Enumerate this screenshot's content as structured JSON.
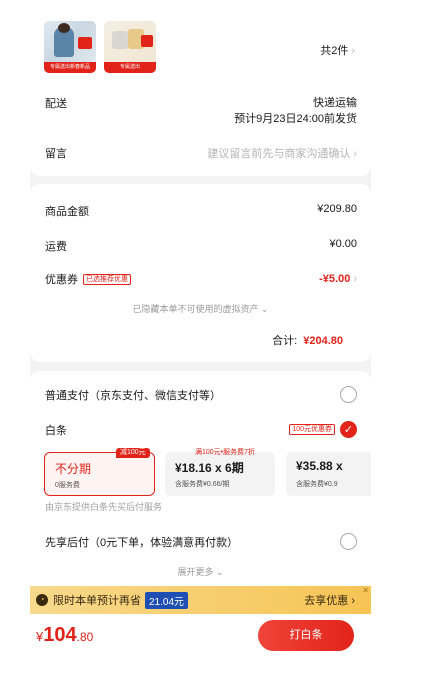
{
  "colors": {
    "accent": "#e2231a",
    "banner_bg": "#f7c75a",
    "page_bg": "#f3f3f3"
  },
  "product": {
    "count_label": "共2件",
    "thumbs": [
      {
        "caption": "专属送出新春新品"
      },
      {
        "caption": "专属送出"
      }
    ]
  },
  "shipping": {
    "label": "配送",
    "method": "快递运输",
    "eta": "预计9月23日24:00前发货"
  },
  "remark": {
    "label": "留言",
    "placeholder": "建议留言前先与商家沟通确认"
  },
  "price": {
    "goods_label": "商品金额",
    "goods_value": "¥209.80",
    "freight_label": "运费",
    "freight_value": "¥0.00",
    "coupon_label": "优惠券",
    "coupon_tag": "已选推荐优惠",
    "coupon_value": "-¥5.00",
    "hidden_note": "已隐藏本单不可使用的虚拟资产",
    "total_label": "合计:",
    "total_value": "¥204.80"
  },
  "payment": {
    "normal_label": "普通支付（京东支付、微信支付等）",
    "baitiao_label": "白条",
    "baitiao_tag": "100元优惠券",
    "plans": [
      {
        "badge": "减100元",
        "title": "不分期",
        "sub": "0服务费"
      },
      {
        "badge": "满100元•服务费7折",
        "title": "¥18.16 x 6期",
        "sub": "含服务费¥0.66/期"
      },
      {
        "title": "¥35.88 x",
        "sub": "含服务费¥0.9"
      }
    ],
    "provider_note": "由京东提供白条先买后付服务",
    "later_label": "先享后付（0元下单，体验满意再付款）",
    "expand_more": "展开更多"
  },
  "banner": {
    "text": "限时本单预计再省",
    "amount": "21.04元",
    "action": "去享优惠"
  },
  "footer": {
    "currency": "¥",
    "price_int": "104",
    "price_dec": ".80",
    "pay_button": "打白条"
  }
}
